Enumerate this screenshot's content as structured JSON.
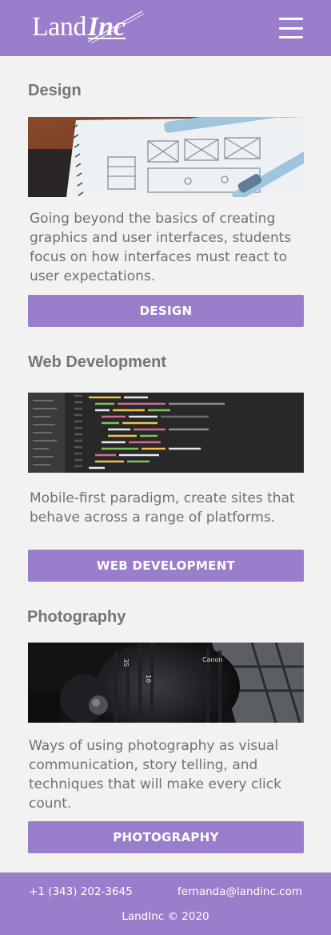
{
  "brand": {
    "logo_part1": "Land",
    "logo_part2": "Inc",
    "logo_name": "LandInc"
  },
  "header": {
    "menu_icon": "hamburger-icon"
  },
  "colors": {
    "accent": "#9a7dcb",
    "background": "#f2f2f2",
    "heading": "#75757c",
    "body_text": "#707077"
  },
  "sections": [
    {
      "title": "Design",
      "image": "sketch-wireframe-notebook-image",
      "description": "Going beyond the basics of creating graphics and user interfaces, students focus on how interfaces must react to user expectations.",
      "button": "DESIGN"
    },
    {
      "title": "Web Development",
      "image": "code-editor-screen-image",
      "description": "Mobile-first paradigm, create sites that behave across a range of platforms.",
      "button": "WEB DEVELOPMENT"
    },
    {
      "title": "Photography",
      "image": "camera-lens-image",
      "description": "Ways of using photography as visual communication, story telling, and techniques that will make every click count.",
      "button": "PHOTOGRAPHY"
    }
  ],
  "footer": {
    "phone": "+1 (343) 202-3645",
    "email": "fernanda@landinc.com",
    "copyright": "LandInc © 2020"
  }
}
